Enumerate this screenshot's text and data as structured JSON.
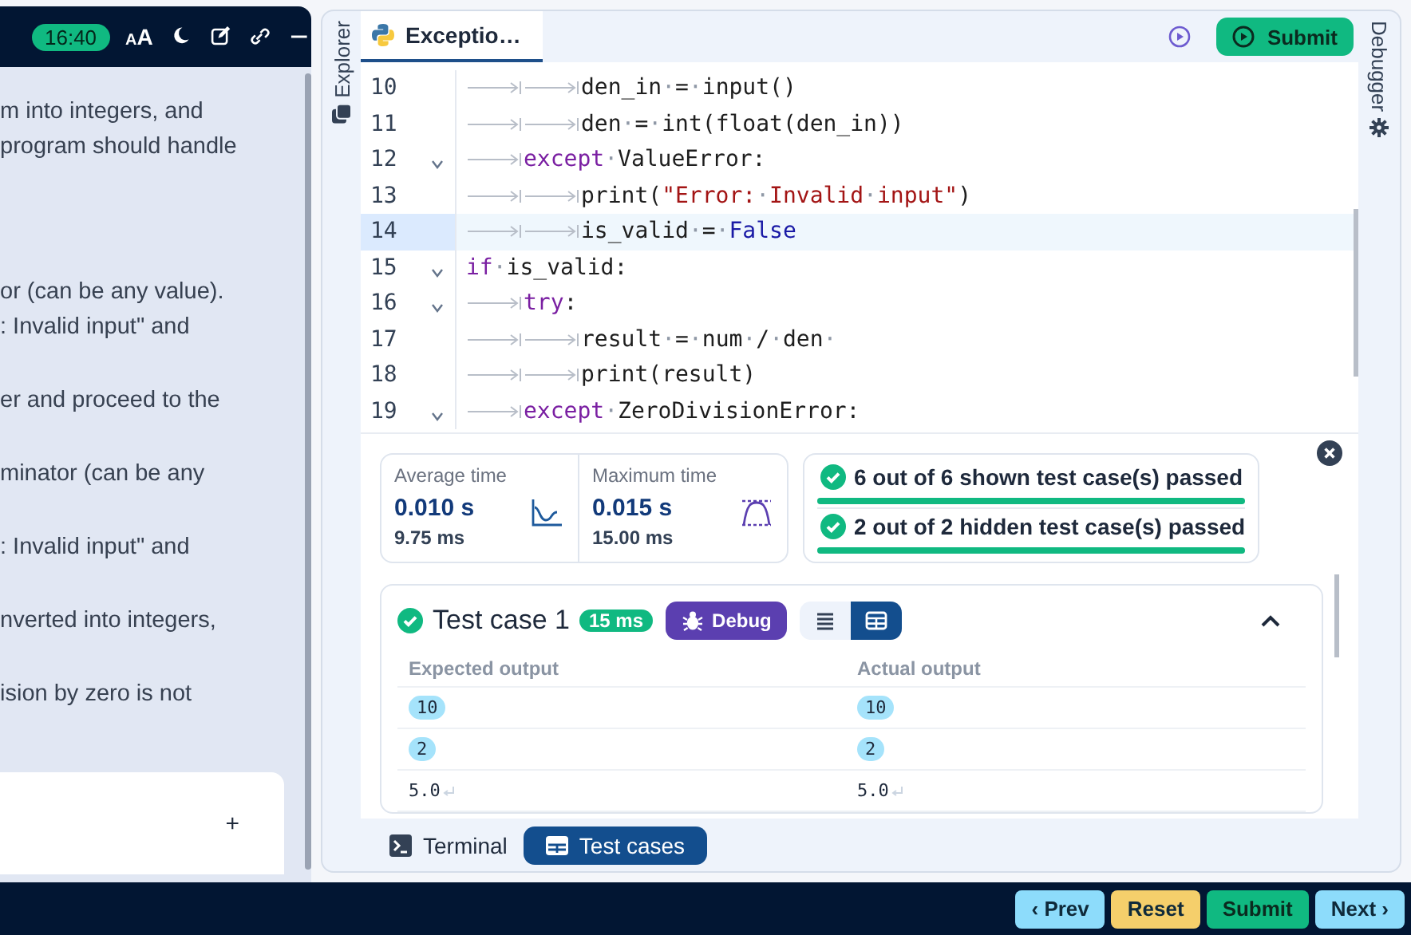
{
  "left_panel": {
    "time": "16:40",
    "font_size_label": "AA",
    "header_icons": [
      {
        "kind": "moon"
      },
      {
        "kind": "edit"
      },
      {
        "kind": "link"
      },
      {
        "kind": "minimize"
      }
    ],
    "paragraphs": [
      {
        "lines": [
          "m into integers, and",
          "program should handle"
        ]
      },
      {
        "lines": [
          "or (can be any value).",
          ": Invalid input\" and"
        ]
      },
      {
        "lines": [
          "er and proceed to the"
        ]
      },
      {
        "lines": [
          "minator (can be any"
        ]
      },
      {
        "lines": [
          ": Invalid input\" and"
        ]
      },
      {
        "lines": [
          "nverted into integers,"
        ]
      },
      {
        "lines": [
          "ision by zero is not"
        ]
      }
    ],
    "input_card": {
      "add_label": "+"
    }
  },
  "editor": {
    "explorer_label": "Explorer",
    "debugger_label": "Debugger",
    "file_tab": {
      "label": "Exceptio…",
      "selected": true
    },
    "submit_label": "Submit",
    "lines": [
      {
        "number": "10",
        "fold": false,
        "current": false,
        "tokens": [
          {
            "kind": "tab"
          },
          {
            "kind": "tab"
          },
          {
            "kind": "plain",
            "text": "den_in"
          },
          {
            "kind": "space",
            "text": "·"
          },
          {
            "kind": "plain",
            "text": "="
          },
          {
            "kind": "space",
            "text": "·"
          },
          {
            "kind": "plain",
            "text": "input()"
          }
        ]
      },
      {
        "number": "11",
        "fold": false,
        "current": false,
        "tokens": [
          {
            "kind": "tab"
          },
          {
            "kind": "tab"
          },
          {
            "kind": "plain",
            "text": "den"
          },
          {
            "kind": "space",
            "text": "·"
          },
          {
            "kind": "plain",
            "text": "="
          },
          {
            "kind": "space",
            "text": "·"
          },
          {
            "kind": "plain",
            "text": "int(float(den_in))"
          }
        ]
      },
      {
        "number": "12",
        "fold": true,
        "current": false,
        "tokens": [
          {
            "kind": "tab"
          },
          {
            "kind": "keyword",
            "text": "except"
          },
          {
            "kind": "space",
            "text": "·"
          },
          {
            "kind": "plain",
            "text": "ValueError:"
          }
        ]
      },
      {
        "number": "13",
        "fold": false,
        "current": false,
        "tokens": [
          {
            "kind": "tab"
          },
          {
            "kind": "tab"
          },
          {
            "kind": "plain",
            "text": "print("
          },
          {
            "kind": "string",
            "text": "\"Error:"
          },
          {
            "kind": "space",
            "text": "·"
          },
          {
            "kind": "string",
            "text": "Invalid"
          },
          {
            "kind": "space",
            "text": "·"
          },
          {
            "kind": "string",
            "text": "input\""
          },
          {
            "kind": "plain",
            "text": ")"
          }
        ]
      },
      {
        "number": "14",
        "fold": false,
        "current": true,
        "tokens": [
          {
            "kind": "tab"
          },
          {
            "kind": "tab"
          },
          {
            "kind": "plain",
            "text": "is_valid"
          },
          {
            "kind": "space",
            "text": "·"
          },
          {
            "kind": "plain",
            "text": "="
          },
          {
            "kind": "space",
            "text": "·"
          },
          {
            "kind": "constant",
            "text": "False"
          }
        ]
      },
      {
        "number": "15",
        "fold": true,
        "current": false,
        "tokens": [
          {
            "kind": "keyword",
            "text": "if"
          },
          {
            "kind": "space",
            "text": "·"
          },
          {
            "kind": "plain",
            "text": "is_valid:"
          }
        ]
      },
      {
        "number": "16",
        "fold": true,
        "current": false,
        "tokens": [
          {
            "kind": "tab"
          },
          {
            "kind": "keyword",
            "text": "try"
          },
          {
            "kind": "plain",
            "text": ":"
          }
        ]
      },
      {
        "number": "17",
        "fold": false,
        "current": false,
        "tokens": [
          {
            "kind": "tab"
          },
          {
            "kind": "tab"
          },
          {
            "kind": "plain",
            "text": "result"
          },
          {
            "kind": "space",
            "text": "·"
          },
          {
            "kind": "plain",
            "text": "="
          },
          {
            "kind": "space",
            "text": "·"
          },
          {
            "kind": "plain",
            "text": "num"
          },
          {
            "kind": "space",
            "text": "·"
          },
          {
            "kind": "plain",
            "text": "/"
          },
          {
            "kind": "space",
            "text": "·"
          },
          {
            "kind": "plain",
            "text": "den"
          },
          {
            "kind": "space",
            "text": "·"
          }
        ]
      },
      {
        "number": "18",
        "fold": false,
        "current": false,
        "tokens": [
          {
            "kind": "tab"
          },
          {
            "kind": "tab"
          },
          {
            "kind": "plain",
            "text": "print(result)"
          }
        ]
      },
      {
        "number": "19",
        "fold": true,
        "current": false,
        "tokens": [
          {
            "kind": "tab"
          },
          {
            "kind": "keyword",
            "text": "except"
          },
          {
            "kind": "space",
            "text": "·"
          },
          {
            "kind": "plain",
            "text": "ZeroDivisionError:"
          }
        ]
      }
    ]
  },
  "results": {
    "stats": [
      {
        "label": "Average time",
        "value": "0.010 s",
        "detail": "9.75 ms",
        "kind": "wave"
      },
      {
        "label": "Maximum time",
        "value": "0.015 s",
        "detail": "15.00 ms",
        "kind": "peak"
      }
    ],
    "summaries": [
      {
        "text": "6 out of 6 shown test case(s) passed",
        "level": 1
      },
      {
        "text": "2 out of 2 hidden test case(s) passed",
        "level": 1
      }
    ],
    "test_case": {
      "title": "Test case 1",
      "time": "15 ms",
      "debug_label": "Debug",
      "expanded": true,
      "views": [
        {
          "kind": "list",
          "selected": false
        },
        {
          "kind": "table",
          "selected": true
        }
      ],
      "columns": [
        "Expected output",
        "Actual output"
      ],
      "rows": [
        {
          "kind": "chip",
          "cells": [
            "10",
            "10"
          ]
        },
        {
          "kind": "chip",
          "cells": [
            "2",
            "2"
          ]
        },
        {
          "kind": "plain",
          "cells": [
            "5.0",
            "5.0"
          ]
        }
      ]
    }
  },
  "bottom_tabs": [
    {
      "label": "Terminal",
      "kind": "terminal",
      "selected": false
    },
    {
      "label": "Test cases",
      "kind": "table",
      "selected": true
    }
  ],
  "footer_buttons": [
    {
      "label": "‹ Prev",
      "kind": "nav"
    },
    {
      "label": "Reset",
      "kind": "reset"
    },
    {
      "label": "Submit",
      "kind": "submit"
    },
    {
      "label": "Next ›",
      "kind": "nav"
    }
  ]
}
